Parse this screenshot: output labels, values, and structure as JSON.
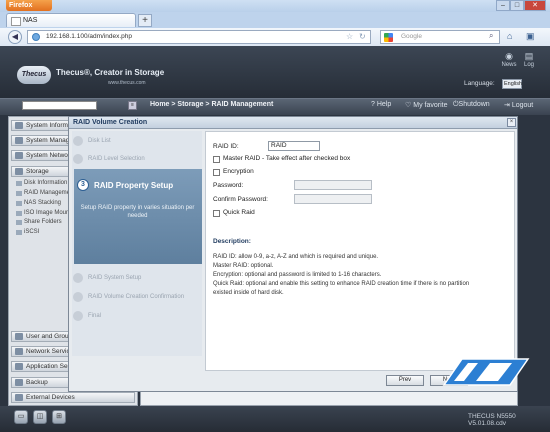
{
  "browser": {
    "menu_button": "Firefox",
    "window_controls": {
      "minimize": "–",
      "maximize": "□",
      "close": "✕"
    },
    "tab_title": "NAS",
    "new_tab": "+",
    "url": "192.168.1.100/adm/index.php",
    "search_placeholder": "Google"
  },
  "header": {
    "logo_text": "Thecus",
    "tagline": "Thecus®, Creator in Storage",
    "website": "www.thecus.com",
    "news_label": "News",
    "log_label": "Log",
    "language_label": "Language:",
    "language_value": "English"
  },
  "toolbar": {
    "breadcrumb": "Home > Storage > RAID Management",
    "help": "Help",
    "favorite": "My favorite",
    "shutdown": "Shutdown",
    "logout": "Logout"
  },
  "sidebar": {
    "categories": [
      "System Information",
      "System Management",
      "System Network",
      "Storage",
      "User and Group",
      "Network Service",
      "Application Server",
      "Backup",
      "External Devices"
    ],
    "storage_items": [
      "Disk Information",
      "RAID Management",
      "NAS Stacking",
      "ISO Image Mounting",
      "Share Folders",
      "iSCSI"
    ]
  },
  "dialog": {
    "title": "RAID Volume Creation",
    "close": "×",
    "steps": [
      "Disk List",
      "RAID Level Selection",
      "RAID Property Setup",
      "RAID System Setup",
      "RAID Volume Creation Confirmation",
      "Final"
    ],
    "active_step_number": "3",
    "active_step_title": "RAID Property Setup",
    "active_step_description": "Setup RAID property in varies situation per needed",
    "form": {
      "raid_id_label": "RAID ID:",
      "raid_id_value": "RAID",
      "master_raid_label": "Master RAID - Take effect after checked box",
      "encryption_label": "Encryption",
      "password_label": "Password:",
      "confirm_password_label": "Confirm Password:",
      "quick_raid_label": "Quick Raid"
    },
    "description_title": "Description:",
    "description_lines": [
      "RAID ID: allow 0-9, a-z, A-Z and which is required and unique.",
      "Master RAID: optional.",
      "Encryption: optional and password is limited to 1-16 characters.",
      "Quick Raid: optional and enable this setting to enhance RAID creation time if there is no partition",
      "existed inside of hard disk."
    ],
    "prev_button": "Prev",
    "next_button": "Next"
  },
  "footer": {
    "version": "THECUS N5550 V5.01.08.cdv"
  }
}
